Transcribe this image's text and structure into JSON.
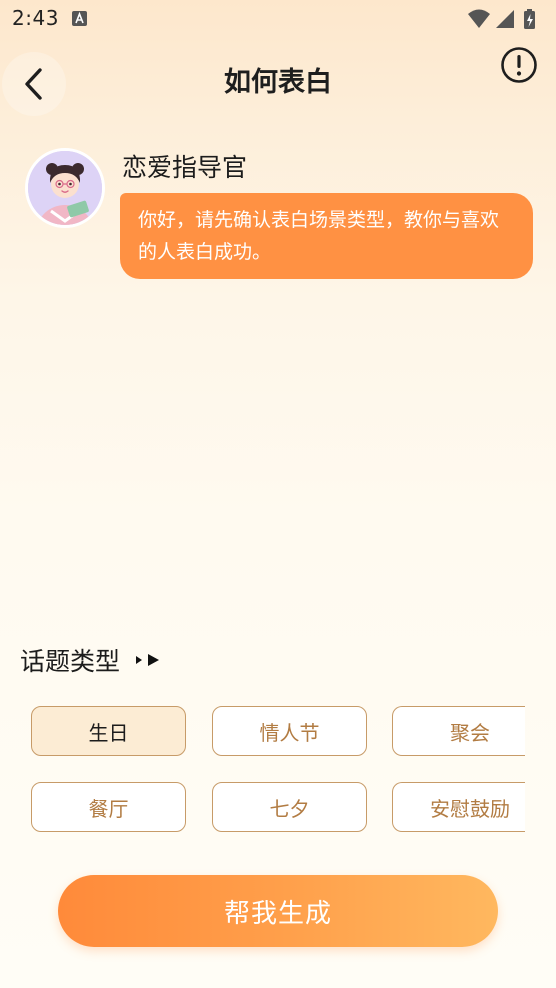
{
  "status_bar": {
    "time": "2:43",
    "icons": [
      "keyboard-a-icon",
      "wifi-icon",
      "signal-icon",
      "battery-charging-icon"
    ]
  },
  "header": {
    "title": "如何表白",
    "back_icon": "chevron-left-icon",
    "info_icon": "info-circle-icon"
  },
  "chat": {
    "bot_name": "恋爱指导官",
    "avatar_icon": "advisor-avatar",
    "message": "你好，请先确认表白场景类型，教你与喜欢的人表白成功。"
  },
  "topics": {
    "title": "话题类型",
    "arrow_icon": "play-arrows-icon",
    "selected": "生日",
    "items": [
      {
        "label": "生日"
      },
      {
        "label": "情人节"
      },
      {
        "label": "聚会"
      },
      {
        "label": "餐厅"
      },
      {
        "label": "七夕"
      },
      {
        "label": "安慰鼓励"
      }
    ]
  },
  "actions": {
    "generate_label": "帮我生成"
  },
  "colors": {
    "accent_orange": "#ff9143",
    "chip_border": "#c79b68",
    "chip_text": "#b27c43",
    "chip_selected_bg": "#fcecd4"
  }
}
